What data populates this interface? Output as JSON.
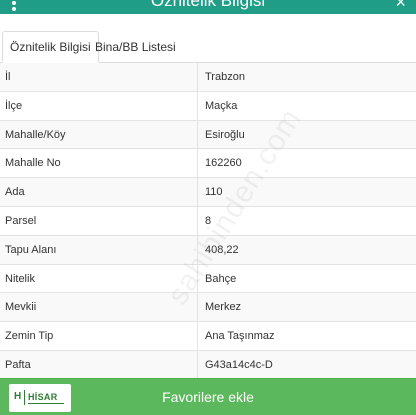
{
  "window": {
    "title": "Öznitelik Bilgisi",
    "close_glyph": "×"
  },
  "tabs": [
    {
      "label": "Öznitelik Bilgisi",
      "active": true
    },
    {
      "label": "Bina/BB Listesi",
      "active": false
    }
  ],
  "attributes": [
    {
      "key": "İl",
      "value": "Trabzon"
    },
    {
      "key": "İlçe",
      "value": "Maçka"
    },
    {
      "key": "Mahalle/Köy",
      "value": "Esiroğlu"
    },
    {
      "key": "Mahalle No",
      "value": "162260"
    },
    {
      "key": "Ada",
      "value": "110"
    },
    {
      "key": "Parsel",
      "value": "8"
    },
    {
      "key": "Tapu Alanı",
      "value": "408,22"
    },
    {
      "key": "Nitelik",
      "value": "Bahçe"
    },
    {
      "key": "Mevkii",
      "value": "Merkez"
    },
    {
      "key": "Zemin Tip",
      "value": "Ana Taşınmaz"
    },
    {
      "key": "Pafta",
      "value": "G43a14c4c-D"
    }
  ],
  "footer": {
    "favorite_label": "Favorilere ekle",
    "logo": {
      "letter": "H",
      "name": "HİSAR"
    }
  },
  "watermark": "sahibinden.com",
  "colors": {
    "header": "#1f9d86",
    "footer": "#5cb85c",
    "logo_green": "#2e7d32"
  }
}
